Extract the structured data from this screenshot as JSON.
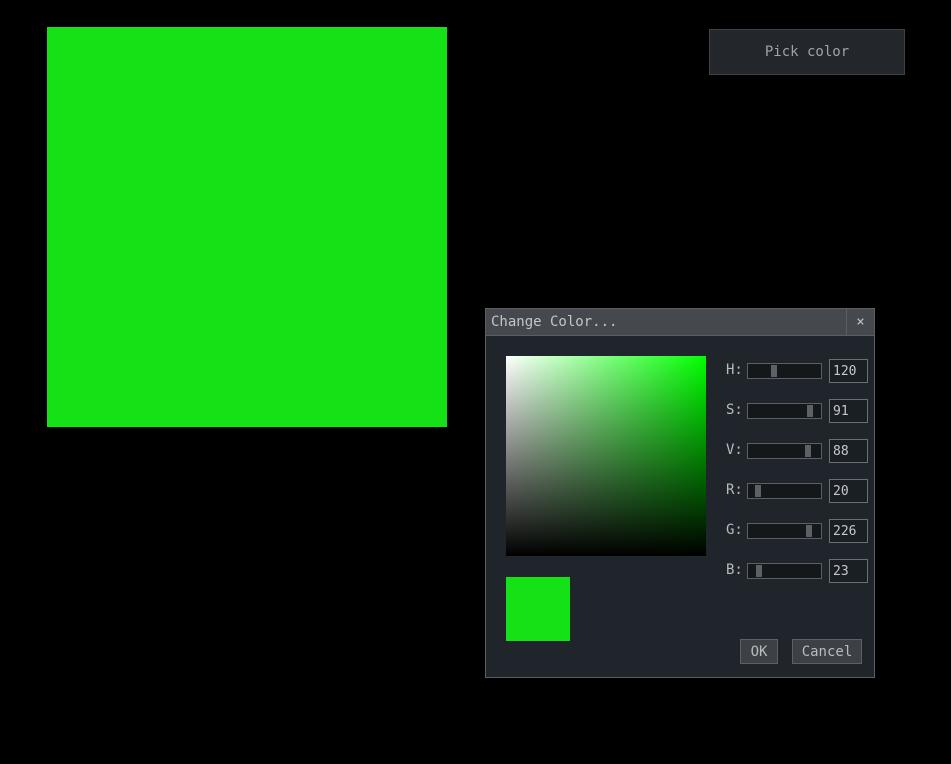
{
  "colors": {
    "selected": "#14e217",
    "hue_pure": "#00ff00",
    "background": "#000000"
  },
  "toolbar": {
    "pick_color_label": "Pick color"
  },
  "dialog": {
    "title": "Change Color...",
    "close_glyph": "×",
    "close_icon": "close-icon",
    "ok_label": "OK",
    "cancel_label": "Cancel",
    "channels": [
      {
        "label": "H:",
        "value": "120",
        "fraction": 0.333
      },
      {
        "label": "S:",
        "value": "91",
        "fraction": 0.91
      },
      {
        "label": "V:",
        "value": "88",
        "fraction": 0.88
      },
      {
        "label": "R:",
        "value": "20",
        "fraction": 0.078
      },
      {
        "label": "G:",
        "value": "226",
        "fraction": 0.886
      },
      {
        "label": "B:",
        "value": "23",
        "fraction": 0.09
      }
    ]
  }
}
